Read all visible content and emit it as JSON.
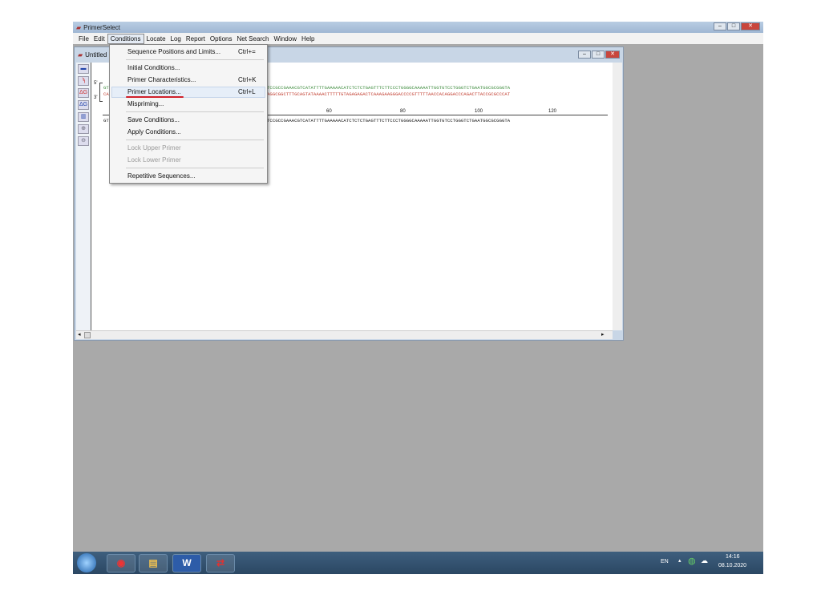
{
  "app": {
    "title": "PrimerSelect"
  },
  "menubar": [
    "File",
    "Edit",
    "Conditions",
    "Locate",
    "Log",
    "Report",
    "Options",
    "Net Search",
    "Window",
    "Help"
  ],
  "doc": {
    "title": "Untitled"
  },
  "strands": {
    "five": "5'",
    "three": "3'"
  },
  "sequences": {
    "top_prefix": "GT",
    "top": "TCCGCCGAAACGTCATATTTTGAAAAACATCTCTCTGAGTTTCTTCCCTGGGGCAAAAATTGGTGTCCTGGGTCTGAATGGCGCGGGTA",
    "bottom_prefix": "CA",
    "bottom": "AGGCGGCTTTGCAGTATAAAACTTTTTGTAGAGAGACTCAAAGAAGGGACCCCGTTTTTAACCACAGGACCCAGACTTACCGCGCCCAT",
    "consensus_prefix": "GT",
    "consensus": "TCCGCCGAAACGTCATATTTTGAAAAACATCTCTCTGAGTTTCTTCCCTGGGGCAAAAATTGGTGTCCTGGGTCTGAATGGCGCGGGTA"
  },
  "ruler": [
    "60",
    "80",
    "100",
    "120"
  ],
  "conditions_menu": [
    {
      "label": "Sequence Positions and Limits...",
      "shortcut": "Ctrl+=",
      "enabled": true
    },
    {
      "label": "Initial Conditions...",
      "shortcut": "",
      "enabled": true
    },
    {
      "label": "Primer Characteristics...",
      "shortcut": "Ctrl+K",
      "enabled": true
    },
    {
      "label": "Primer Locations...",
      "shortcut": "Ctrl+L",
      "enabled": true,
      "highlighted": true
    },
    {
      "label": "Mispriming...",
      "shortcut": "",
      "enabled": true
    },
    {
      "label": "Save Conditions...",
      "shortcut": "",
      "enabled": true
    },
    {
      "label": "Apply Conditions...",
      "shortcut": "",
      "enabled": true
    },
    {
      "label": "Lock Upper Primer",
      "shortcut": "",
      "enabled": false
    },
    {
      "label": "Lock Lower Primer",
      "shortcut": "",
      "enabled": false
    },
    {
      "label": "Repetitive Sequences...",
      "shortcut": "",
      "enabled": true
    }
  ],
  "tray": {
    "lang": "EN",
    "time": "14:16",
    "date": "08.10.2020"
  },
  "colors": {
    "top_seq": "#3a8a3a",
    "bottom_seq": "#c0392b",
    "underline": "#d0202a"
  }
}
